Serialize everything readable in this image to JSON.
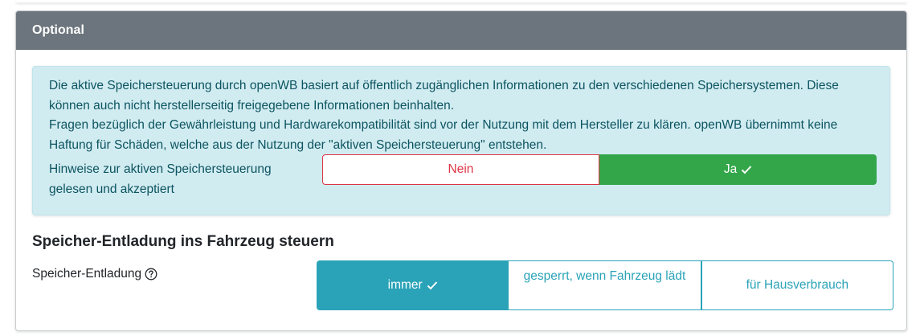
{
  "card": {
    "header": "Optional"
  },
  "alert": {
    "paragraph1": "Die aktive Speichersteuerung durch openWB basiert auf öffentlich zugänglichen Informationen zu den verschiedenen Speichersystemen. Diese können auch nicht herstellerseitig freigegebene Informationen beinhalten.",
    "paragraph2": "Fragen bezüglich der Gewährleistung und Hardwarekompatibilität sind vor der Nutzung mit dem Hersteller zu klären. openWB übernimmt keine Haftung für Schäden, welche aus der Nutzung der \"aktiven Speichersteuerung\" entstehen.",
    "ack_label": "Hinweise zur aktiven Speichersteuerung gelesen und akzeptiert",
    "options": {
      "no": "Nein",
      "yes": "Ja"
    },
    "selected": "yes"
  },
  "discharge": {
    "title": "Speicher-Entladung ins Fahrzeug steuern",
    "label": "Speicher-Entladung",
    "help_icon": "question-circle-icon",
    "options": {
      "always": "immer",
      "locked": "gesperrt, wenn Fahrzeug lädt",
      "house": "für Hausverbrauch"
    },
    "selected": "always"
  },
  "colors": {
    "header_bg": "#6c757d",
    "alert_bg": "#d1ecf1",
    "alert_text": "#0c5460",
    "danger": "#dc3545",
    "success": "#33a64a",
    "info": "#2aa3b8"
  }
}
